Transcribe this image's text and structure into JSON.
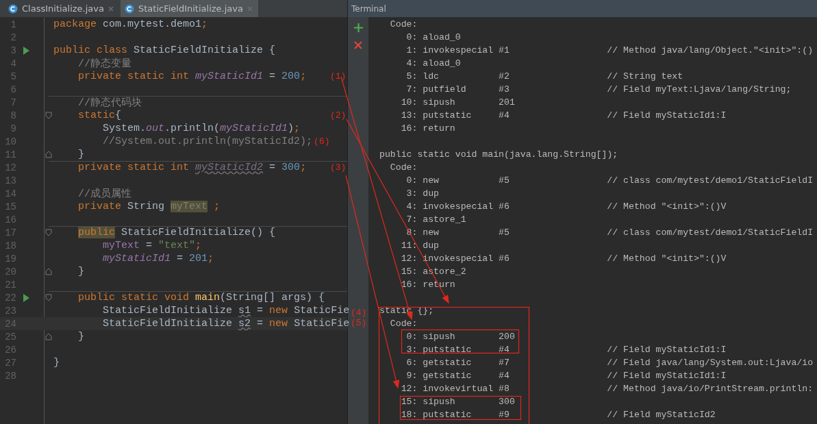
{
  "editor": {
    "tabs": [
      {
        "label": "ClassInitialize.java",
        "selected": false
      },
      {
        "label": "StaticFieldInitialize.java",
        "selected": true
      }
    ],
    "lines": [
      {
        "number": "1",
        "tokens": [
          {
            "text": "package",
            "kind": "keyword"
          },
          {
            "text": " com.mytest.demo1",
            "kind": "plain"
          },
          {
            "text": ";",
            "kind": "keyword"
          }
        ]
      },
      {
        "number": "2"
      },
      {
        "number": "3",
        "run": true,
        "tokens": [
          {
            "text": "public class",
            "kind": "keyword"
          },
          {
            "text": " StaticFieldInitialize {",
            "kind": "plain"
          }
        ]
      },
      {
        "number": "4",
        "tokens": [
          {
            "text": "    //静态变量",
            "kind": "comment"
          }
        ]
      },
      {
        "number": "5",
        "note": {
          "text": "(1)",
          "kind": "margin"
        },
        "tokens": [
          {
            "text": "    private static int ",
            "kind": "keyword"
          },
          {
            "text": "myStaticId1",
            "kind": "static_field"
          },
          {
            "text": " = ",
            "kind": "plain"
          },
          {
            "text": "200",
            "kind": "number"
          },
          {
            "text": ";",
            "kind": "keyword"
          }
        ]
      },
      {
        "number": "6"
      },
      {
        "number": "7",
        "divider": true,
        "tokens": [
          {
            "text": "    //静态代码块",
            "kind": "comment"
          }
        ]
      },
      {
        "number": "8",
        "fold_open": true,
        "note": {
          "text": "(2)",
          "kind": "margin"
        },
        "tokens": [
          {
            "text": "    static",
            "kind": "keyword"
          },
          {
            "text": "{",
            "kind": "plain"
          }
        ]
      },
      {
        "number": "9",
        "tokens": [
          {
            "text": "        System.",
            "kind": "plain"
          },
          {
            "text": "out",
            "kind": "static_field"
          },
          {
            "text": ".println(",
            "kind": "plain"
          },
          {
            "text": "myStaticId1",
            "kind": "static_field"
          },
          {
            "text": ")",
            "kind": "plain"
          },
          {
            "text": ";",
            "kind": "keyword"
          }
        ]
      },
      {
        "number": "10",
        "note": {
          "text": "(6)",
          "kind": "inline"
        },
        "tokens": [
          {
            "text": "        //System.out.println(myStaticId2);",
            "kind": "comment"
          }
        ]
      },
      {
        "number": "11",
        "fold_close": true,
        "tokens": [
          {
            "text": "    }",
            "kind": "plain"
          }
        ]
      },
      {
        "number": "12",
        "divider": true,
        "note": {
          "text": "(3)",
          "kind": "margin"
        },
        "tokens": [
          {
            "text": "    private static int ",
            "kind": "keyword"
          },
          {
            "text": "myStaticId2",
            "kind": "unused_static_field"
          },
          {
            "text": " = ",
            "kind": "plain"
          },
          {
            "text": "300",
            "kind": "number"
          },
          {
            "text": ";",
            "kind": "keyword"
          }
        ]
      },
      {
        "number": "13"
      },
      {
        "number": "14",
        "tokens": [
          {
            "text": "    //成员属性",
            "kind": "comment"
          }
        ]
      },
      {
        "number": "15",
        "tokens": [
          {
            "text": "    private",
            "kind": "keyword"
          },
          {
            "text": " String ",
            "kind": "plain"
          },
          {
            "text": "myText",
            "kind": "highlighted_field"
          },
          {
            "text": " ;",
            "kind": "keyword"
          }
        ]
      },
      {
        "number": "16"
      },
      {
        "number": "17",
        "divider": true,
        "fold_open": true,
        "tokens": [
          {
            "text": "    public",
            "kind": "highlighted_keyword"
          },
          {
            "text": " StaticFieldInitialize() {",
            "kind": "plain"
          }
        ]
      },
      {
        "number": "18",
        "tokens": [
          {
            "text": "        myText",
            "kind": "field"
          },
          {
            "text": " = ",
            "kind": "plain"
          },
          {
            "text": "\"text\"",
            "kind": "string"
          },
          {
            "text": ";",
            "kind": "keyword"
          }
        ]
      },
      {
        "number": "19",
        "tokens": [
          {
            "text": "        myStaticId1",
            "kind": "static_field"
          },
          {
            "text": " = ",
            "kind": "plain"
          },
          {
            "text": "201",
            "kind": "number"
          },
          {
            "text": ";",
            "kind": "keyword"
          }
        ]
      },
      {
        "number": "20",
        "fold_close": true,
        "tokens": [
          {
            "text": "    }",
            "kind": "plain"
          }
        ]
      },
      {
        "number": "21"
      },
      {
        "number": "22",
        "divider": true,
        "run": true,
        "fold_open": true,
        "tokens": [
          {
            "text": "    public static void ",
            "kind": "keyword"
          },
          {
            "text": "main",
            "kind": "method"
          },
          {
            "text": "(String[] args) {",
            "kind": "plain"
          }
        ]
      },
      {
        "number": "23",
        "tokens": [
          {
            "text": "        StaticFieldInitialize ",
            "kind": "plain"
          },
          {
            "text": "s1",
            "kind": "unused_local"
          },
          {
            "text": " = ",
            "kind": "plain"
          },
          {
            "text": "new",
            "kind": "keyword"
          },
          {
            "text": " StaticFie",
            "kind": "plain"
          }
        ]
      },
      {
        "number": "24",
        "current": true,
        "tokens": [
          {
            "text": "        StaticFieldInitialize ",
            "kind": "plain"
          },
          {
            "text": "s2",
            "kind": "unused_local"
          },
          {
            "text": " = ",
            "kind": "plain"
          },
          {
            "text": "new",
            "kind": "keyword"
          },
          {
            "text": " StaticFie",
            "kind": "plain"
          }
        ]
      },
      {
        "number": "25",
        "fold_close": true,
        "tokens": [
          {
            "text": "    }",
            "kind": "plain"
          }
        ]
      },
      {
        "number": "26"
      },
      {
        "number": "27",
        "tokens": [
          {
            "text": "}",
            "kind": "plain"
          }
        ]
      },
      {
        "number": "28"
      }
    ]
  },
  "annotations": [
    {
      "text": "(4)"
    },
    {
      "text": "(5)"
    }
  ],
  "terminal": {
    "title": "Terminal",
    "rows": [
      {
        "kind": "section",
        "text": "Code:"
      },
      {
        "kind": "instruction",
        "offset": "0:",
        "op": "aload_0"
      },
      {
        "kind": "instruction",
        "offset": "1:",
        "op": "invokespecial",
        "arg": "#1",
        "comment": "// Method java/lang/Object.\"<init>\":()"
      },
      {
        "kind": "instruction",
        "offset": "4:",
        "op": "aload_0"
      },
      {
        "kind": "instruction",
        "offset": "5:",
        "op": "ldc",
        "arg": "#2",
        "comment": "// String text"
      },
      {
        "kind": "instruction",
        "offset": "7:",
        "op": "putfield",
        "arg": "#3",
        "comment": "// Field myText:Ljava/lang/String;"
      },
      {
        "kind": "instruction",
        "offset": "10:",
        "op": "sipush",
        "arg": "201"
      },
      {
        "kind": "instruction",
        "offset": "13:",
        "op": "putstatic",
        "arg": "#4",
        "comment": "// Field myStaticId1:I"
      },
      {
        "kind": "instruction",
        "offset": "16:",
        "op": "return"
      },
      {
        "kind": "blank"
      },
      {
        "kind": "signature",
        "text": "public static void main(java.lang.String[]);"
      },
      {
        "kind": "section",
        "text": "Code:"
      },
      {
        "kind": "instruction",
        "offset": "0:",
        "op": "new",
        "arg": "#5",
        "comment": "// class com/mytest/demo1/StaticFieldI"
      },
      {
        "kind": "instruction",
        "offset": "3:",
        "op": "dup"
      },
      {
        "kind": "instruction",
        "offset": "4:",
        "op": "invokespecial",
        "arg": "#6",
        "comment": "// Method \"<init>\":()V"
      },
      {
        "kind": "instruction",
        "offset": "7:",
        "op": "astore_1"
      },
      {
        "kind": "instruction",
        "offset": "8:",
        "op": "new",
        "arg": "#5",
        "comment": "// class com/mytest/demo1/StaticFieldI"
      },
      {
        "kind": "instruction",
        "offset": "11:",
        "op": "dup"
      },
      {
        "kind": "instruction",
        "offset": "12:",
        "op": "invokespecial",
        "arg": "#6",
        "comment": "// Method \"<init>\":()V"
      },
      {
        "kind": "instruction",
        "offset": "15:",
        "op": "astore_2"
      },
      {
        "kind": "instruction",
        "offset": "16:",
        "op": "return"
      },
      {
        "kind": "blank"
      },
      {
        "kind": "signature",
        "text": "static {};"
      },
      {
        "kind": "section",
        "text": "Code:"
      },
      {
        "kind": "instruction",
        "offset": "0:",
        "op": "sipush",
        "arg": "200"
      },
      {
        "kind": "instruction",
        "offset": "3:",
        "op": "putstatic",
        "arg": "#4",
        "comment": "// Field myStaticId1:I"
      },
      {
        "kind": "instruction",
        "offset": "6:",
        "op": "getstatic",
        "arg": "#7",
        "comment": "// Field java/lang/System.out:Ljava/io"
      },
      {
        "kind": "instruction",
        "offset": "9:",
        "op": "getstatic",
        "arg": "#4",
        "comment": "// Field myStaticId1:I"
      },
      {
        "kind": "instruction",
        "offset": "12:",
        "op": "invokevirtual",
        "arg": "#8",
        "comment": "// Method java/io/PrintStream.println:"
      },
      {
        "kind": "instruction",
        "offset": "15:",
        "op": "sipush",
        "arg": "300"
      },
      {
        "kind": "instruction",
        "offset": "18:",
        "op": "putstatic",
        "arg": "#9",
        "comment": "// Field myStaticId2"
      }
    ]
  }
}
